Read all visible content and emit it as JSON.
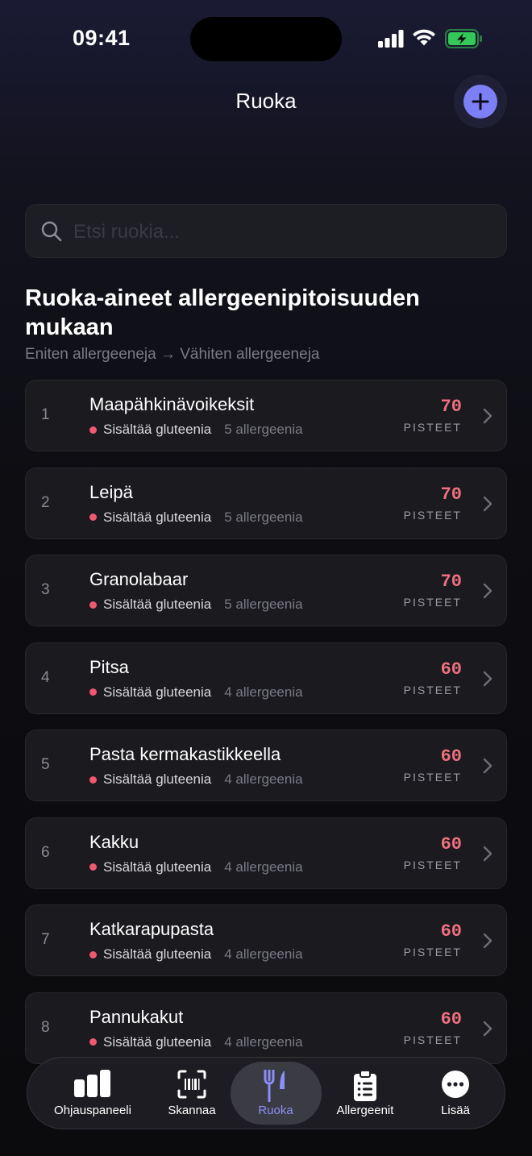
{
  "status_bar": {
    "time": "09:41"
  },
  "header": {
    "title": "Ruoka"
  },
  "search": {
    "placeholder": "Etsi ruokia..."
  },
  "section": {
    "title": "Ruoka-aineet allergeenipitoisuuden mukaan",
    "subtitle": "Eniten allergeeneja → Vähiten allergeeneja"
  },
  "foods": [
    {
      "rank": "1",
      "name": "Maapähkinävoikeksit",
      "tag": "Sisältää gluteenia",
      "count": "5 allergeenia",
      "score": "70",
      "score_label": "PISTEET"
    },
    {
      "rank": "2",
      "name": "Leipä",
      "tag": "Sisältää gluteenia",
      "count": "5 allergeenia",
      "score": "70",
      "score_label": "PISTEET"
    },
    {
      "rank": "3",
      "name": "Granolabaar",
      "tag": "Sisältää gluteenia",
      "count": "5 allergeenia",
      "score": "70",
      "score_label": "PISTEET"
    },
    {
      "rank": "4",
      "name": "Pitsa",
      "tag": "Sisältää gluteenia",
      "count": "4 allergeenia",
      "score": "60",
      "score_label": "PISTEET"
    },
    {
      "rank": "5",
      "name": "Pasta kermakastikkeella",
      "tag": "Sisältää gluteenia",
      "count": "4 allergeenia",
      "score": "60",
      "score_label": "PISTEET"
    },
    {
      "rank": "6",
      "name": "Kakku",
      "tag": "Sisältää gluteenia",
      "count": "4 allergeenia",
      "score": "60",
      "score_label": "PISTEET"
    },
    {
      "rank": "7",
      "name": "Katkarapupasta",
      "tag": "Sisältää gluteenia",
      "count": "4 allergeenia",
      "score": "60",
      "score_label": "PISTEET"
    },
    {
      "rank": "8",
      "name": "Pannukakut",
      "tag": "Sisältää gluteenia",
      "count": "4 allergeenia",
      "score": "60",
      "score_label": "PISTEET"
    }
  ],
  "tabs": [
    {
      "label": "Ohjauspaneeli",
      "icon": "bar-chart-icon"
    },
    {
      "label": "Skannaa",
      "icon": "barcode-scan-icon"
    },
    {
      "label": "Ruoka",
      "icon": "fork-knife-icon",
      "active": true
    },
    {
      "label": "Allergeenit",
      "icon": "clipboard-list-icon"
    },
    {
      "label": "Lisää",
      "icon": "more-icon"
    }
  ],
  "colors": {
    "accent": "#7c7ff5",
    "score": "#f07080",
    "dot": "#f0596e",
    "active_tab_label": "#8b8ef7"
  }
}
